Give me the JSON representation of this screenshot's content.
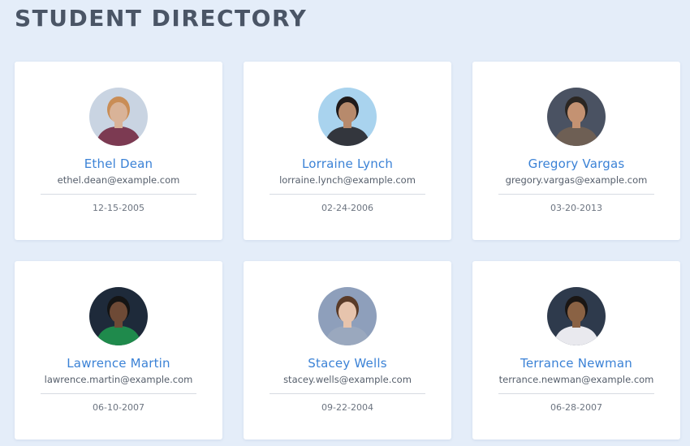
{
  "page": {
    "title": "STUDENT DIRECTORY"
  },
  "students": [
    {
      "name": "Ethel Dean",
      "email": "ethel.dean@example.com",
      "dob": "12-15-2005",
      "avatar": {
        "bg": "#c9d4e2",
        "skin": "#d9b398",
        "hair": "#c98d56",
        "shirt": "#7c3a52"
      }
    },
    {
      "name": "Lorraine Lynch",
      "email": "lorraine.lynch@example.com",
      "dob": "02-24-2006",
      "avatar": {
        "bg": "#a9d3ee",
        "skin": "#b78a6c",
        "hair": "#1f1a1a",
        "shirt": "#33363d"
      }
    },
    {
      "name": "Gregory Vargas",
      "email": "gregory.vargas@example.com",
      "dob": "03-20-2013",
      "avatar": {
        "bg": "#4a5262",
        "skin": "#c49272",
        "hair": "#2b2622",
        "shirt": "#6e5f54"
      }
    },
    {
      "name": "Lawrence Martin",
      "email": "lawrence.martin@example.com",
      "dob": "06-10-2007",
      "avatar": {
        "bg": "#1e2a3a",
        "skin": "#6e4a36",
        "hair": "#141414",
        "shirt": "#1f8a4c"
      }
    },
    {
      "name": "Stacey Wells",
      "email": "stacey.wells@example.com",
      "dob": "09-22-2004",
      "avatar": {
        "bg": "#8e9fbb",
        "skin": "#e7c4ad",
        "hair": "#5a3b28",
        "shirt": "#9aa8be"
      }
    },
    {
      "name": "Terrance Newman",
      "email": "terrance.newman@example.com",
      "dob": "06-28-2007",
      "avatar": {
        "bg": "#2e3a4c",
        "skin": "#8a6244",
        "hair": "#1a1614",
        "shirt": "#e9e9ee"
      }
    }
  ]
}
